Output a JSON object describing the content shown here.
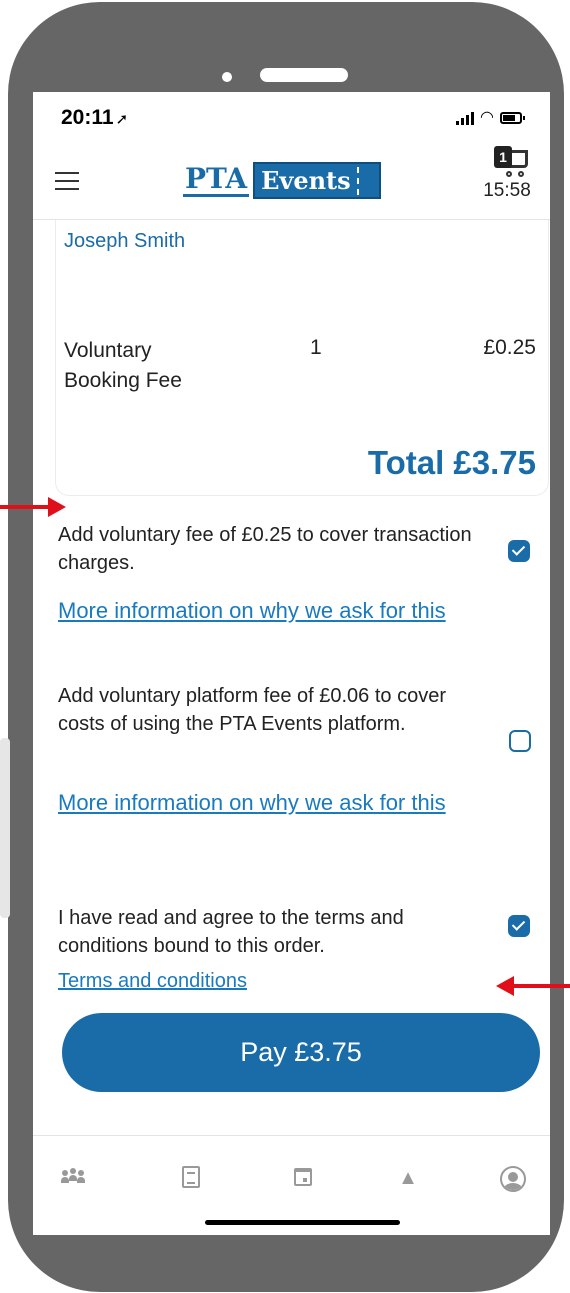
{
  "status_bar": {
    "time": "20:11",
    "location_glyph": "⌯"
  },
  "header": {
    "logo_pta": "PTA",
    "logo_events": "Events",
    "cart_count": "1",
    "cart_timer": "15:58"
  },
  "order": {
    "attendee_name": "Joseph Smith",
    "fee_item_name": "Voluntary Booking Fee",
    "fee_item_qty": "1",
    "fee_item_price": "£0.25",
    "total": "Total £3.75"
  },
  "options": {
    "voluntary_fee_text": "Add voluntary fee of £0.25 to cover transaction charges.",
    "voluntary_fee_checked": true,
    "voluntary_fee_link": "More information on why we ask for this",
    "platform_fee_text": "Add voluntary platform fee of £0.06 to cover costs of using the PTA Events platform.",
    "platform_fee_checked": false,
    "platform_fee_link": "More information on why we ask for this",
    "terms_text": "I have read and agree to the terms and conditions bound to this order.",
    "terms_checked": true,
    "terms_link": "Terms and conditions"
  },
  "pay_button_label": "Pay  £3.75",
  "nav": {
    "icons": [
      "people-icon",
      "document-icon",
      "calendar-icon",
      "bell-icon",
      "user-icon"
    ],
    "bell_glyph": "🔔"
  },
  "colors": {
    "brand_blue": "#1a6ca8",
    "link_blue": "#1a7ac0",
    "frame_gray": "#666666",
    "annotation_red": "#e0101a"
  }
}
